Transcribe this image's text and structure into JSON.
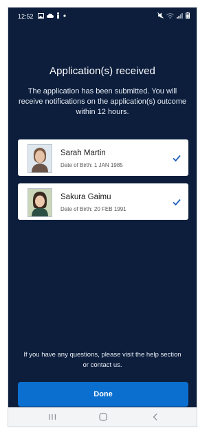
{
  "status_bar": {
    "time": "12:52",
    "left_icons": [
      "gallery-icon",
      "cloud-icon",
      "figure-icon",
      "dot-icon"
    ],
    "right_icons": [
      "mute-icon",
      "wifi-icon",
      "signal-icon",
      "battery-icon"
    ]
  },
  "title": "Application(s) received",
  "message": "The application has been submitted. You will receive notifications on the application(s) outcome within 12 hours.",
  "applicants": [
    {
      "name": "Sarah Martin",
      "dob": "Date of Birth: 1 JAN 1985"
    },
    {
      "name": "Sakura Gaimu",
      "dob": "Date of Birth: 20 FEB 1991"
    }
  ],
  "help_text": "If you have any questions, please visit the help section or contact us.",
  "done_label": "Done",
  "colors": {
    "background": "#0c1e3c",
    "accent": "#0b6fd0",
    "check": "#1f5fb8",
    "card": "#ffffff"
  }
}
